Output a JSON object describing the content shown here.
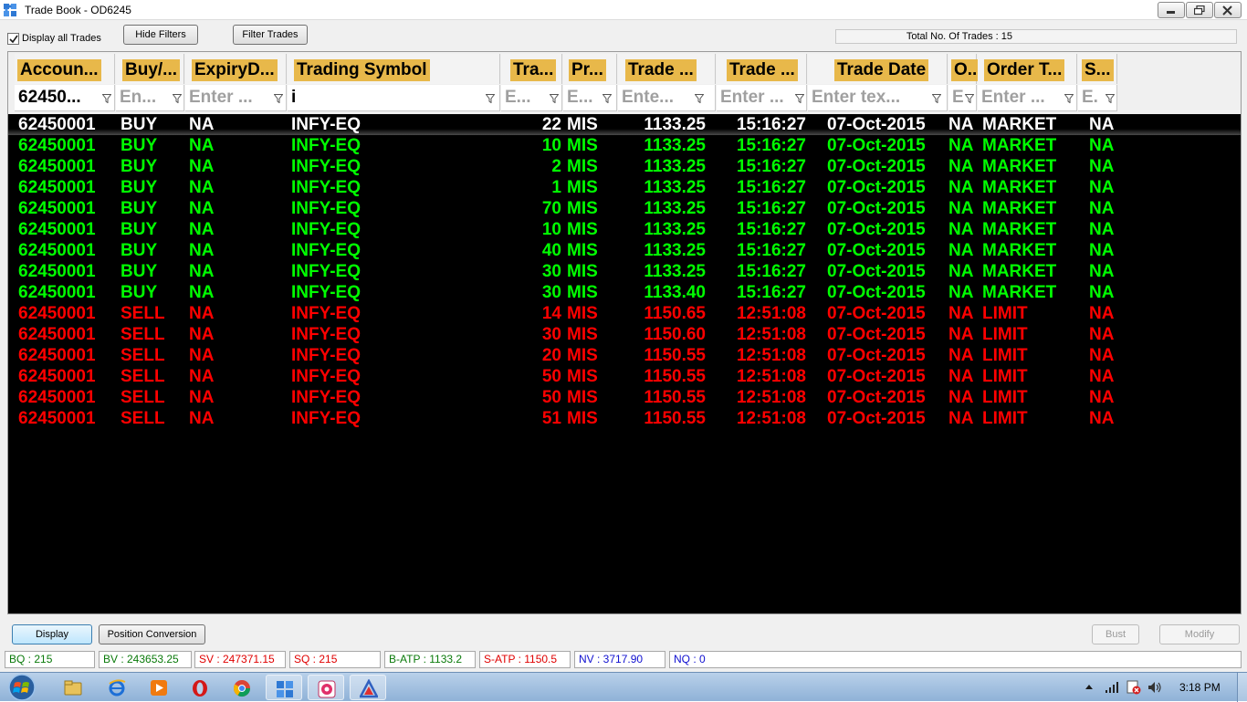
{
  "window": {
    "title": "Trade Book - OD6245"
  },
  "toolbar": {
    "display_all_label": "Display all Trades",
    "display_all_checked": true,
    "hide_filters_label": "Hide Filters",
    "filter_trades_label": "Filter Trades",
    "total_trades_text": "Total No. Of Trades : 15"
  },
  "grid": {
    "columns": [
      {
        "key": "account",
        "header": "Accoun...",
        "filter": "62450...",
        "filter_active": true
      },
      {
        "key": "side",
        "header": "Buy/...",
        "filter": "En..."
      },
      {
        "key": "expiry",
        "header": "ExpiryD...",
        "filter": "Enter ..."
      },
      {
        "key": "symbol",
        "header": "Trading Symbol",
        "filter": "i",
        "filter_active": true
      },
      {
        "key": "qty",
        "header": "Tra...",
        "filter": "E..."
      },
      {
        "key": "product",
        "header": "Pr...",
        "filter": "E..."
      },
      {
        "key": "price",
        "header": "Trade ...",
        "filter": "Ente..."
      },
      {
        "key": "time",
        "header": "Trade ...",
        "filter": "Enter ..."
      },
      {
        "key": "date",
        "header": "Trade Date",
        "filter": "Enter tex..."
      },
      {
        "key": "o",
        "header": "O..",
        "filter": "E"
      },
      {
        "key": "ordertype",
        "header": "Order T...",
        "filter": "Enter ..."
      },
      {
        "key": "s",
        "header": "S...",
        "filter": "E."
      }
    ],
    "rows": [
      {
        "account": "62450001",
        "side": "BUY",
        "expiry": "NA",
        "symbol": "INFY-EQ",
        "qty": "22",
        "product": "MIS",
        "price": "1133.25",
        "time": "15:16:27",
        "date": "07-Oct-2015",
        "o": "NA",
        "ordertype": "MARKET",
        "s": "NA",
        "color": "#ffffff"
      },
      {
        "account": "62450001",
        "side": "BUY",
        "expiry": "NA",
        "symbol": "INFY-EQ",
        "qty": "10",
        "product": "MIS",
        "price": "1133.25",
        "time": "15:16:27",
        "date": "07-Oct-2015",
        "o": "NA",
        "ordertype": "MARKET",
        "s": "NA",
        "color": "#00ff00"
      },
      {
        "account": "62450001",
        "side": "BUY",
        "expiry": "NA",
        "symbol": "INFY-EQ",
        "qty": "2",
        "product": "MIS",
        "price": "1133.25",
        "time": "15:16:27",
        "date": "07-Oct-2015",
        "o": "NA",
        "ordertype": "MARKET",
        "s": "NA",
        "color": "#00ff00"
      },
      {
        "account": "62450001",
        "side": "BUY",
        "expiry": "NA",
        "symbol": "INFY-EQ",
        "qty": "1",
        "product": "MIS",
        "price": "1133.25",
        "time": "15:16:27",
        "date": "07-Oct-2015",
        "o": "NA",
        "ordertype": "MARKET",
        "s": "NA",
        "color": "#00ff00"
      },
      {
        "account": "62450001",
        "side": "BUY",
        "expiry": "NA",
        "symbol": "INFY-EQ",
        "qty": "70",
        "product": "MIS",
        "price": "1133.25",
        "time": "15:16:27",
        "date": "07-Oct-2015",
        "o": "NA",
        "ordertype": "MARKET",
        "s": "NA",
        "color": "#00ff00"
      },
      {
        "account": "62450001",
        "side": "BUY",
        "expiry": "NA",
        "symbol": "INFY-EQ",
        "qty": "10",
        "product": "MIS",
        "price": "1133.25",
        "time": "15:16:27",
        "date": "07-Oct-2015",
        "o": "NA",
        "ordertype": "MARKET",
        "s": "NA",
        "color": "#00ff00"
      },
      {
        "account": "62450001",
        "side": "BUY",
        "expiry": "NA",
        "symbol": "INFY-EQ",
        "qty": "40",
        "product": "MIS",
        "price": "1133.25",
        "time": "15:16:27",
        "date": "07-Oct-2015",
        "o": "NA",
        "ordertype": "MARKET",
        "s": "NA",
        "color": "#00ff00"
      },
      {
        "account": "62450001",
        "side": "BUY",
        "expiry": "NA",
        "symbol": "INFY-EQ",
        "qty": "30",
        "product": "MIS",
        "price": "1133.25",
        "time": "15:16:27",
        "date": "07-Oct-2015",
        "o": "NA",
        "ordertype": "MARKET",
        "s": "NA",
        "color": "#00ff00"
      },
      {
        "account": "62450001",
        "side": "BUY",
        "expiry": "NA",
        "symbol": "INFY-EQ",
        "qty": "30",
        "product": "MIS",
        "price": "1133.40",
        "time": "15:16:27",
        "date": "07-Oct-2015",
        "o": "NA",
        "ordertype": "MARKET",
        "s": "NA",
        "color": "#00ff00"
      },
      {
        "account": "62450001",
        "side": "SELL",
        "expiry": "NA",
        "symbol": "INFY-EQ",
        "qty": "14",
        "product": "MIS",
        "price": "1150.65",
        "time": "12:51:08",
        "date": "07-Oct-2015",
        "o": "NA",
        "ordertype": "LIMIT",
        "s": "NA",
        "color": "#ff0000"
      },
      {
        "account": "62450001",
        "side": "SELL",
        "expiry": "NA",
        "symbol": "INFY-EQ",
        "qty": "30",
        "product": "MIS",
        "price": "1150.60",
        "time": "12:51:08",
        "date": "07-Oct-2015",
        "o": "NA",
        "ordertype": "LIMIT",
        "s": "NA",
        "color": "#ff0000"
      },
      {
        "account": "62450001",
        "side": "SELL",
        "expiry": "NA",
        "symbol": "INFY-EQ",
        "qty": "20",
        "product": "MIS",
        "price": "1150.55",
        "time": "12:51:08",
        "date": "07-Oct-2015",
        "o": "NA",
        "ordertype": "LIMIT",
        "s": "NA",
        "color": "#ff0000"
      },
      {
        "account": "62450001",
        "side": "SELL",
        "expiry": "NA",
        "symbol": "INFY-EQ",
        "qty": "50",
        "product": "MIS",
        "price": "1150.55",
        "time": "12:51:08",
        "date": "07-Oct-2015",
        "o": "NA",
        "ordertype": "LIMIT",
        "s": "NA",
        "color": "#ff0000"
      },
      {
        "account": "62450001",
        "side": "SELL",
        "expiry": "NA",
        "symbol": "INFY-EQ",
        "qty": "50",
        "product": "MIS",
        "price": "1150.55",
        "time": "12:51:08",
        "date": "07-Oct-2015",
        "o": "NA",
        "ordertype": "LIMIT",
        "s": "NA",
        "color": "#ff0000"
      },
      {
        "account": "62450001",
        "side": "SELL",
        "expiry": "NA",
        "symbol": "INFY-EQ",
        "qty": "51",
        "product": "MIS",
        "price": "1150.55",
        "time": "12:51:08",
        "date": "07-Oct-2015",
        "o": "NA",
        "ordertype": "LIMIT",
        "s": "NA",
        "color": "#ff0000"
      }
    ]
  },
  "buttons": {
    "display": "Display",
    "position_conversion": "Position Conversion",
    "bust": "Bust",
    "modify": "Modify"
  },
  "status": {
    "bq": "BQ : 215",
    "bv": "BV : 243653.25",
    "sv": "SV : 247371.15",
    "sq": "SQ : 215",
    "batp": "B-ATP : 1133.2",
    "satp": "S-ATP : 1150.5",
    "nv": "NV : 3717.90",
    "nq": "NQ : 0"
  },
  "taskbar": {
    "items": [
      "explorer-icon",
      "ie-icon",
      "media-player-icon",
      "opera-icon",
      "chrome-icon",
      "puzzle-app-icon",
      "paint-app-icon",
      "triangle-app-icon"
    ],
    "clock": "3:18 PM"
  },
  "colors": {
    "buy": "#00ff00",
    "sell": "#ff0000",
    "selected": "#ffffff",
    "header_highlight": "#e8b84a"
  }
}
